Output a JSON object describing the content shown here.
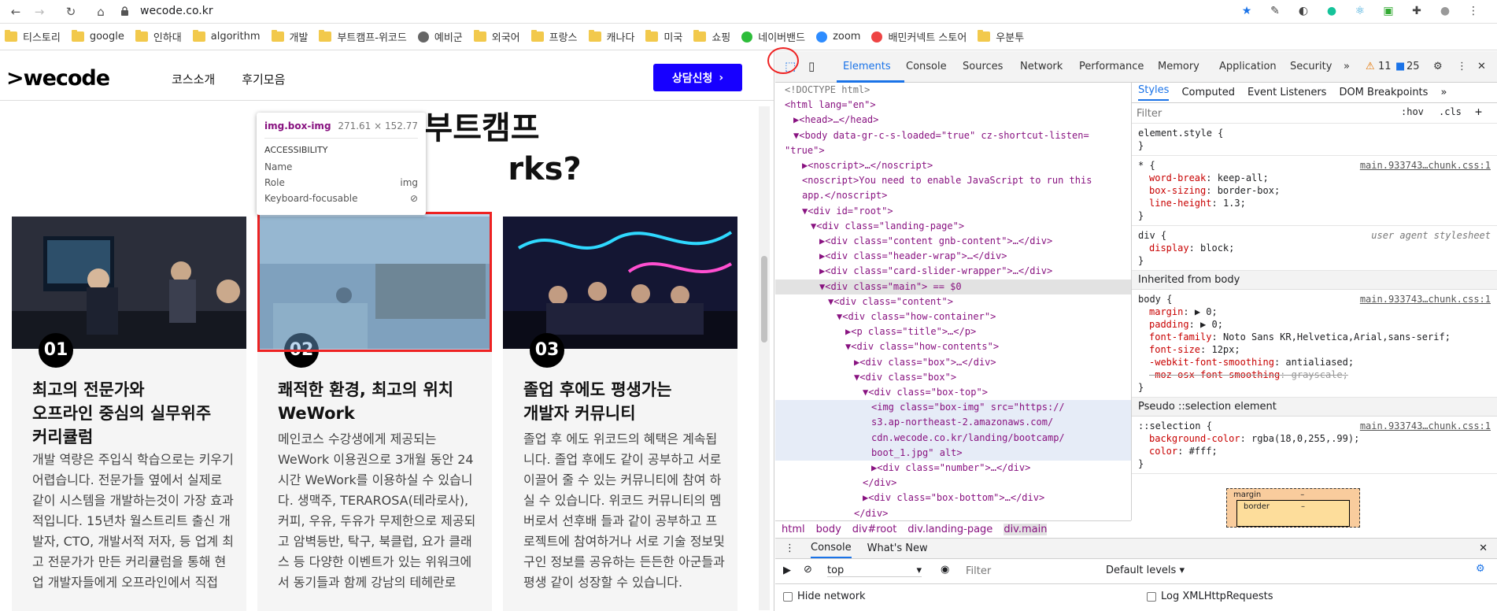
{
  "browser": {
    "url": "wecode.co.kr"
  },
  "bookmarks": [
    {
      "label": "티스토리",
      "icon": "folder"
    },
    {
      "label": "google",
      "icon": "folder"
    },
    {
      "label": "인하대",
      "icon": "folder"
    },
    {
      "label": "algorithm",
      "icon": "folder"
    },
    {
      "label": "개발",
      "icon": "folder"
    },
    {
      "label": "부트캠프-위코드",
      "icon": "folder"
    },
    {
      "label": "예비군",
      "icon": "globe"
    },
    {
      "label": "외국어",
      "icon": "folder"
    },
    {
      "label": "프랑스",
      "icon": "folder"
    },
    {
      "label": "캐나다",
      "icon": "folder"
    },
    {
      "label": "미국",
      "icon": "folder"
    },
    {
      "label": "쇼핑",
      "icon": "folder"
    },
    {
      "label": "네이버밴드",
      "icon": "band"
    },
    {
      "label": "zoom",
      "icon": "zoom"
    },
    {
      "label": "배민커넥트 스토어",
      "icon": "baemin"
    },
    {
      "label": "우분투",
      "icon": "folder"
    }
  ],
  "site": {
    "logo": ">wecode",
    "menu": [
      "코스소개",
      "후기모음"
    ],
    "cta": "상담신청",
    "headline1": "부트캠프",
    "headline2": "rks?",
    "cards": [
      {
        "num": "01",
        "title": "최고의 전문가와\n오프라인 중심의 실무위주\n커리큘럼",
        "body": "개발 역량은 주입식 학습으로는 키우기 어렵습니다. 전문가들 옆에서 실제로 같이 시스템을 개발하는것이 가장 효과적입니다. 15년차 월스트리트 출신 개발자, CTO, 개발서적 저자, 등 업계 최고 전문가가 만든 커리큘럼을 통해 현업 개발자들에게 오프라인에서 직접"
      },
      {
        "num": "02",
        "title": "쾌적한 환경, 최고의 위치\nWeWork",
        "body": "메인코스 수강생에게 제공되는 WeWork 이용권으로 3개월 동안 24시간 WeWork를 이용하실 수 있습니다. 생맥주, TERAROSA(테라로사), 커피, 우유, 두유가 무제한으로 제공되고 암벽등반, 탁구, 북클럽, 요가 클래스 등 다양한 이벤트가 있는 위워크에서 동기들과 함께 강남의 테헤란로"
      },
      {
        "num": "03",
        "title": "졸업 후에도 평생가는\n개발자 커뮤니티",
        "body": "졸업 후 에도 위코드의 혜택은 계속됩니다. 졸업 후에도 같이 공부하고 서로 이끌어 줄 수 있는 커뮤니티에 참여 하실 수 있습니다. 위코드 커뮤니티의 멤버로서 선후배 들과 같이 공부하고 프로젝트에 참여하거나 서로 기술 정보및 구인 정보를 공유하는 든든한 아군들과 평생 같이 성장할 수 있습니다."
      }
    ]
  },
  "tooltip": {
    "tag": "img.box-img",
    "size": "271.61 × 152.77",
    "section": "ACCESSIBILITY",
    "rows": [
      [
        "Name",
        ""
      ],
      [
        "Role",
        "img"
      ],
      [
        "Keyboard-focusable",
        "⊘"
      ]
    ]
  },
  "devtools": {
    "tabs": [
      "Elements",
      "Console",
      "Sources",
      "Network",
      "Performance",
      "Memory",
      "Application",
      "Security"
    ],
    "warnings": "11",
    "messages": "25",
    "dom": [
      {
        "i": 0,
        "html": "<!DOCTYPE html>",
        "k": "c"
      },
      {
        "i": 0,
        "html": "<html lang=\"en\">"
      },
      {
        "i": 1,
        "html": "▶<head>…</head>"
      },
      {
        "i": 1,
        "html": "▼<body data-gr-c-s-loaded=\"true\" cz-shortcut-listen="
      },
      {
        "i": 0,
        "html": "\"true\">"
      },
      {
        "i": 2,
        "html": "▶<noscript>…</noscript>"
      },
      {
        "i": 2,
        "html": "<noscript>You need to enable JavaScript to run this"
      },
      {
        "i": 2,
        "html": "app.</noscript>"
      },
      {
        "i": 2,
        "html": "▼<div id=\"root\">"
      },
      {
        "i": 3,
        "html": "▼<div class=\"landing-page\">"
      },
      {
        "i": 4,
        "html": "▶<div class=\"content gnb-content\">…</div>"
      },
      {
        "i": 4,
        "html": "▶<div class=\"header-wrap\">…</div>"
      },
      {
        "i": 4,
        "html": "▶<div class=\"card-slider-wrapper\">…</div>"
      },
      {
        "i": 4,
        "html": "▼<div class=\"main\"> == $0",
        "sel": true
      },
      {
        "i": 5,
        "html": "▼<div class=\"content\">"
      },
      {
        "i": 6,
        "html": "▼<div class=\"how-container\">"
      },
      {
        "i": 7,
        "html": "▶<p class=\"title\">…</p>"
      },
      {
        "i": 7,
        "html": "▼<div class=\"how-contents\">"
      },
      {
        "i": 8,
        "html": "▶<div class=\"box\">…</div>"
      },
      {
        "i": 8,
        "html": "▼<div class=\"box\">"
      },
      {
        "i": 9,
        "html": "▼<div class=\"box-top\">"
      },
      {
        "i": 10,
        "html": "<img class=\"box-img\" src=\"https://",
        "hl": true
      },
      {
        "i": 10,
        "html": "s3.ap-northeast-2.amazonaws.com/",
        "hl": true
      },
      {
        "i": 10,
        "html": "cdn.wecode.co.kr/landing/bootcamp/",
        "hl": true
      },
      {
        "i": 10,
        "html": "boot_1.jpg\" alt>",
        "hl": true
      },
      {
        "i": 10,
        "html": "▶<div class=\"number\">…</div>"
      },
      {
        "i": 9,
        "html": "</div>"
      },
      {
        "i": 9,
        "html": "▶<div class=\"box-bottom\">…</div>"
      },
      {
        "i": 8,
        "html": "</div>"
      }
    ],
    "styles_tabs": [
      "Styles",
      "Computed",
      "Event Listeners",
      "DOM Breakpoints"
    ],
    "filter_placeholder": "Filter",
    "hov": ":hov",
    "cls": ".cls",
    "rules": [
      {
        "sel": "element.style {",
        "props": [],
        "src": ""
      },
      {
        "sel": "* {",
        "props": [
          [
            "word-break",
            "keep-all"
          ],
          [
            "box-sizing",
            "border-box"
          ],
          [
            "line-height",
            "1.3"
          ]
        ],
        "src": "main.933743…chunk.css:1"
      },
      {
        "sel": "div {",
        "props": [
          [
            "display",
            "block"
          ]
        ],
        "src": "user agent stylesheet"
      }
    ],
    "inherited": "Inherited from body",
    "body_rule": {
      "sel": "body {",
      "src": "main.933743…chunk.css:1",
      "props": [
        [
          "margin",
          "▶ 0"
        ],
        [
          "padding",
          "▶ 0"
        ],
        [
          "font-family",
          "Noto Sans KR,Helvetica,Arial,sans-serif"
        ],
        [
          "font-size",
          "12px"
        ],
        [
          "-webkit-font-smoothing",
          "antialiased"
        ],
        [
          "-moz-osx-font-smoothing",
          "grayscale"
        ]
      ]
    },
    "pseudo": "Pseudo ::selection element",
    "sel_rule": {
      "sel": "::selection {",
      "src": "main.933743…chunk.css:1",
      "props": [
        [
          "background-color",
          "rgba(18,0,255,.99)"
        ],
        [
          "color",
          "#fff"
        ]
      ]
    },
    "boxmodel": {
      "margin": "margin",
      "border": "border",
      "dash": "–"
    },
    "crumbs": [
      "html",
      "body",
      "div#root",
      "div.landing-page",
      "div.main"
    ],
    "console_tabs": [
      "Console",
      "What's New"
    ],
    "context": "top",
    "console_filter": "Filter",
    "levels": "Default levels",
    "hide_network": "Hide network",
    "log_xhr": "Log XMLHttpRequests"
  }
}
